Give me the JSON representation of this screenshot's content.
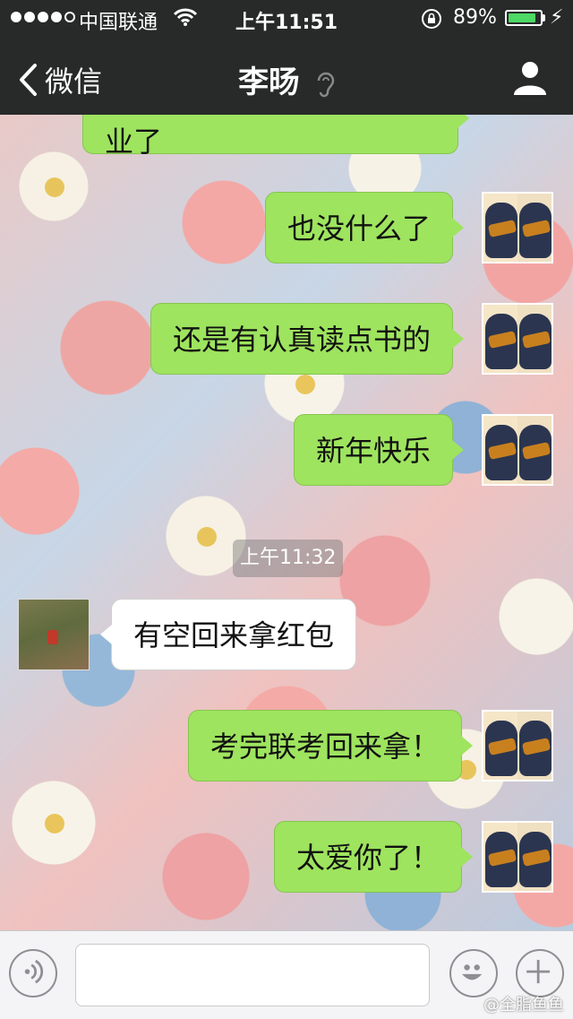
{
  "status_bar": {
    "carrier": "中国联通",
    "time": "上午11:51",
    "battery_percent": "89%",
    "battery_level": 0.89,
    "signal_bars": 4
  },
  "nav": {
    "back_label": "微信",
    "title": "李旸",
    "icons": [
      "chevron-left-icon",
      "earpiece-icon",
      "profile-icon"
    ]
  },
  "messages": [
    {
      "side": "right",
      "text": "业了"
    },
    {
      "side": "right",
      "text": "也没什么了"
    },
    {
      "side": "right",
      "text": "还是有认真读点书的"
    },
    {
      "side": "right",
      "text": "新年快乐"
    },
    {
      "side": "left",
      "text": "有空回来拿红包"
    },
    {
      "side": "right",
      "text": "考完联考回来拿！"
    },
    {
      "side": "right",
      "text": "太爱你了！"
    }
  ],
  "timestamp": "上午11:32",
  "input_bar": {
    "text_value": "",
    "icons": [
      "voice-icon",
      "emoji-icon",
      "plus-icon"
    ]
  },
  "watermark": "@全脂鱼鱼",
  "colors": {
    "nav_bg": "#272a29",
    "bubble_me": "#9ee45f",
    "bubble_friend": "#ffffff",
    "battery": "#4cd964"
  }
}
